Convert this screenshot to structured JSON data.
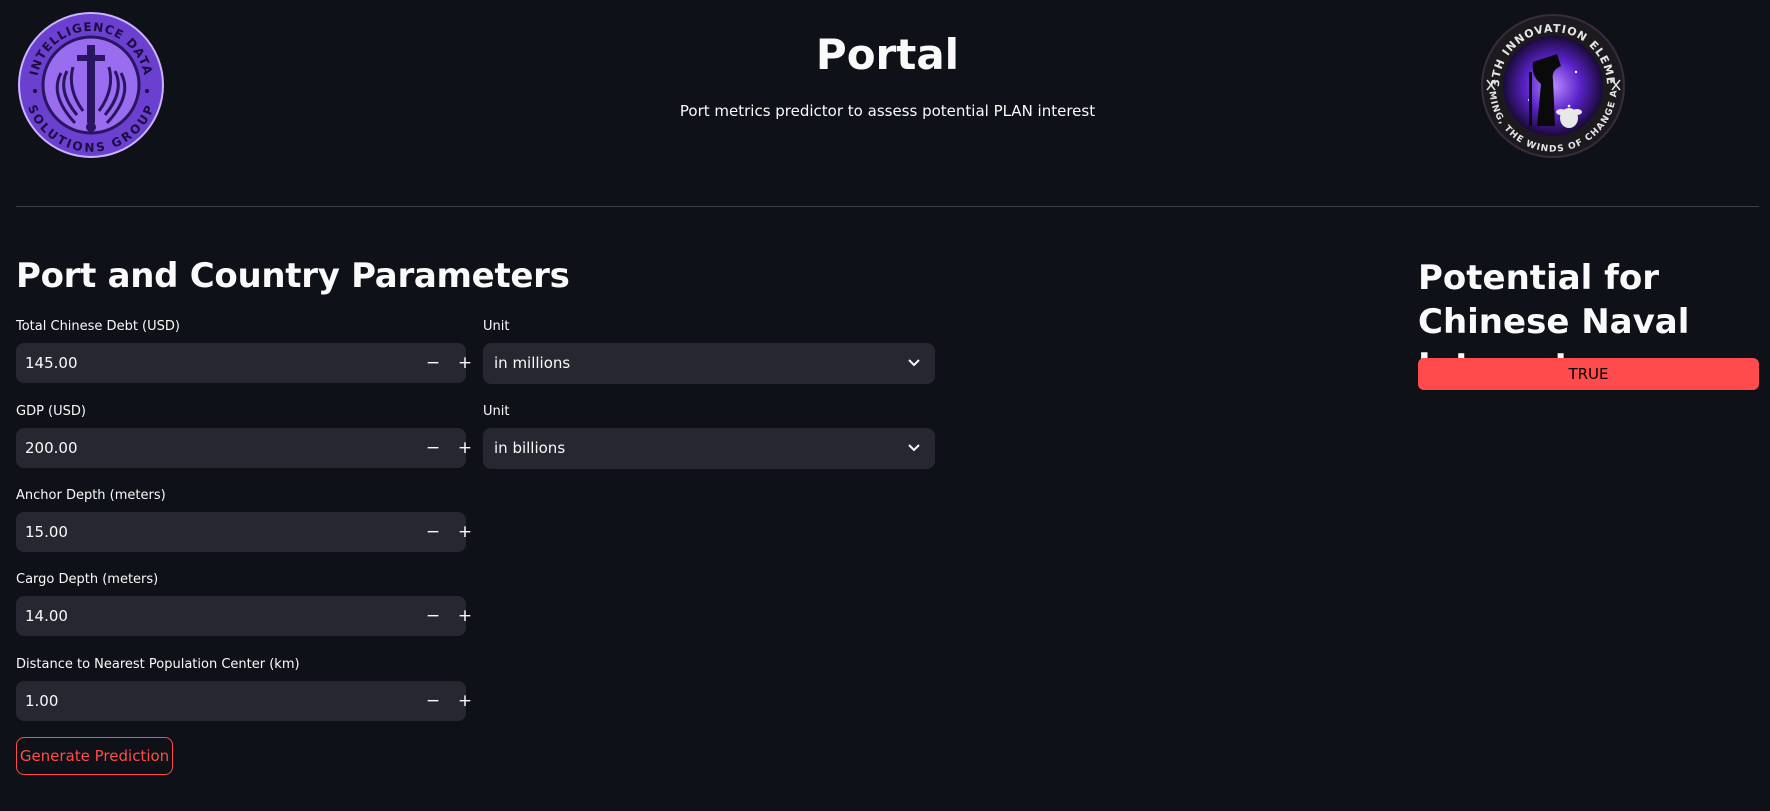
{
  "header": {
    "title": "Portal",
    "subtitle": "Port metrics predictor to assess potential PLAN interest",
    "left_logo": {
      "icon": "intelligence-data-solutions-group-seal",
      "top_text": "INTELLIGENCE DATA",
      "bottom_text": "SOLUTIONS GROUP",
      "color": "#7b4ed8"
    },
    "right_logo": {
      "icon": "513th-innovation-element-seal",
      "top_text": "513TH INNOVATION ELEMENT",
      "bottom_text": "COMING, THE WINDS OF CHANGE ARE",
      "color": "#6a2fd6"
    }
  },
  "parameters": {
    "section_title": "Port and Country Parameters",
    "fields": {
      "debt": {
        "label": "Total Chinese Debt (USD)",
        "value": "145.00"
      },
      "debt_unit": {
        "label": "Unit",
        "value": "in millions"
      },
      "gdp": {
        "label": "GDP (USD)",
        "value": "200.00"
      },
      "gdp_unit": {
        "label": "Unit",
        "value": "in billions"
      },
      "anchor": {
        "label": "Anchor Depth (meters)",
        "value": "15.00"
      },
      "cargo": {
        "label": "Cargo Depth (meters)",
        "value": "14.00"
      },
      "distance": {
        "label": "Distance to Nearest Population Center (km)",
        "value": "1.00"
      }
    },
    "stepper": {
      "minus": "−",
      "plus": "+"
    },
    "button_label": "Generate Prediction"
  },
  "result": {
    "title": "Potential for Chinese Naval Interest:",
    "value": "TRUE",
    "badge_color": "#ff4b4b"
  },
  "theme": {
    "background": "#0e1117",
    "input_background": "#262730",
    "accent": "#ff4b4b"
  }
}
